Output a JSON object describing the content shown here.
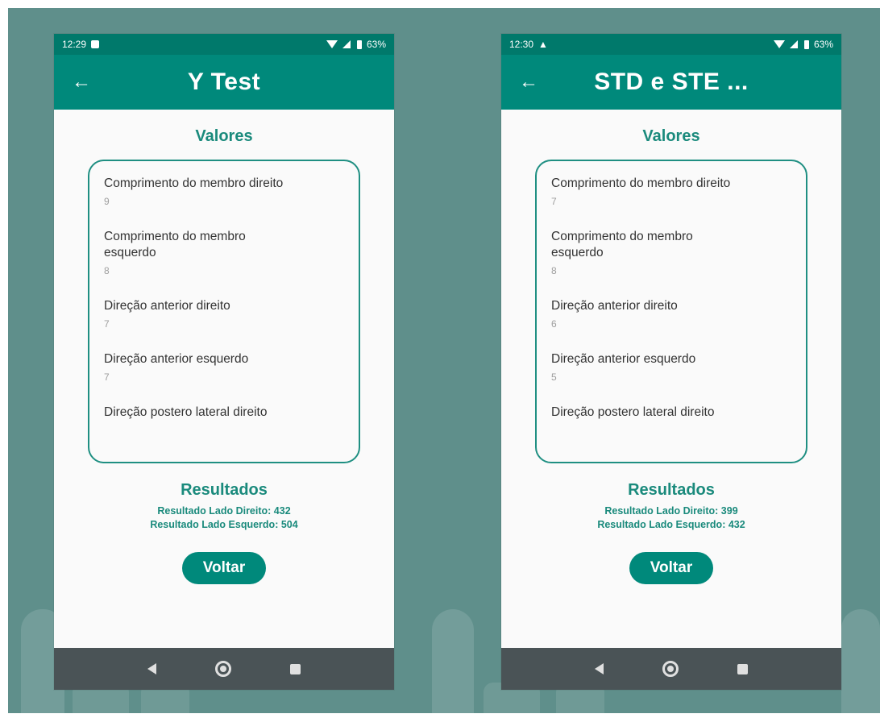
{
  "colors": {
    "primary": "#00897b",
    "primary_dark": "#00796b",
    "accent_text": "#1a8a7c",
    "background": "#5f8f8b"
  },
  "left": {
    "status": {
      "time": "12:29",
      "battery": "63%"
    },
    "title": "Y Test",
    "values_title": "Valores",
    "values": [
      {
        "label": "Comprimento do membro direito",
        "value": "9"
      },
      {
        "label": "Comprimento do membro esquerdo",
        "value": "8"
      },
      {
        "label": "Direção anterior direito",
        "value": "7"
      },
      {
        "label": "Direção anterior esquerdo",
        "value": "7"
      },
      {
        "label": "Direção postero lateral direito",
        "value": ""
      }
    ],
    "results_title": "Resultados",
    "result_right": "Resultado Lado Direito:  432",
    "result_left": "Resultado Lado Esquerdo: 504",
    "button": "Voltar"
  },
  "right": {
    "status": {
      "time": "12:30",
      "battery": "63%"
    },
    "title": "STD e STE ...",
    "values_title": "Valores",
    "values": [
      {
        "label": "Comprimento do membro direito",
        "value": "7"
      },
      {
        "label": "Comprimento do membro esquerdo",
        "value": "8"
      },
      {
        "label": "Direção anterior direito",
        "value": "6"
      },
      {
        "label": "Direção anterior esquerdo",
        "value": "5"
      },
      {
        "label": "Direção postero lateral direito",
        "value": ""
      }
    ],
    "results_title": "Resultados",
    "result_right": "Resultado Lado Direito:  399",
    "result_left": "Resultado Lado Esquerdo: 432",
    "button": "Voltar"
  },
  "icons": {
    "back": "arrow-left-icon",
    "nav_back": "triangle-back-icon",
    "nav_home": "circle-home-icon",
    "nav_recent": "square-recent-icon"
  }
}
